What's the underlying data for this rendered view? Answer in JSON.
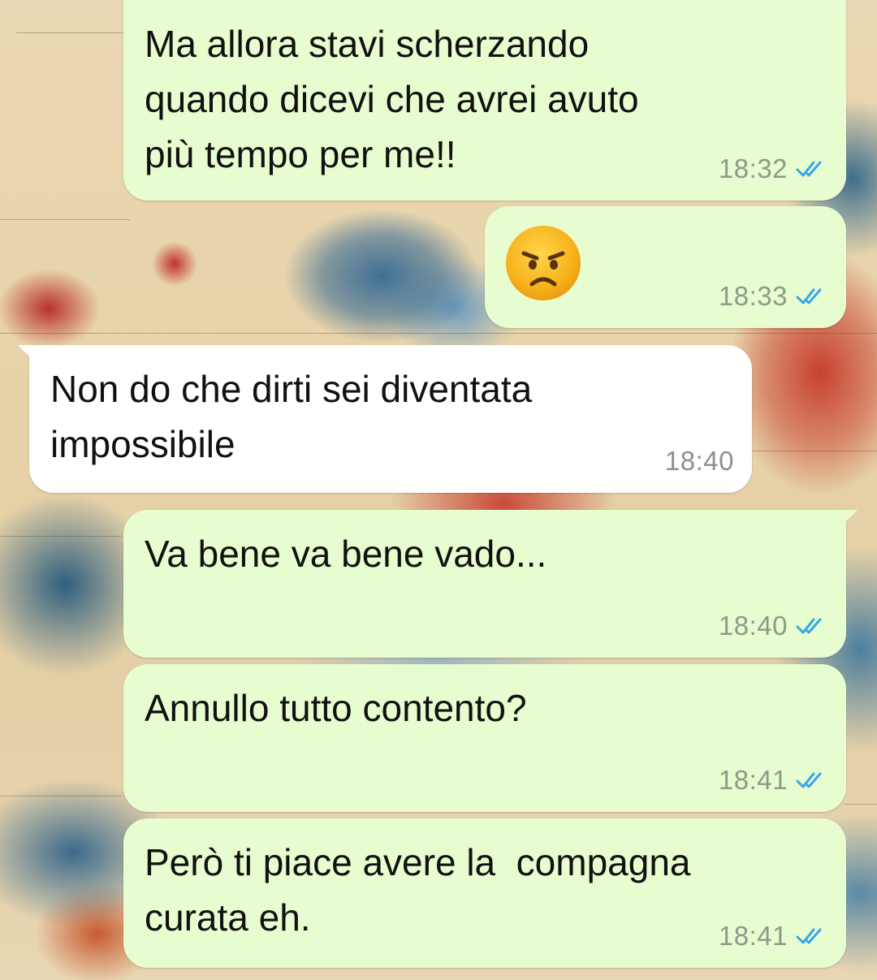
{
  "colors": {
    "outgoing_bubble": "#e7fccf",
    "incoming_bubble": "#ffffff",
    "read_ticks": "#3aa6e8",
    "timestamp": "#8d9a8a"
  },
  "messages": [
    {
      "direction": "outgoing",
      "text": "Ma allora stavi scherzando\nquando dicevi che avrei avuto\npiù tempo per me!!",
      "time": "18:32",
      "status_icon": "double-check-read-icon"
    },
    {
      "direction": "outgoing",
      "emoji": "angry-face-emoji",
      "text": "",
      "time": "18:33",
      "status_icon": "double-check-read-icon"
    },
    {
      "direction": "incoming",
      "text": "Non do che dirti sei diventata\nimpossibile",
      "time": "18:40"
    },
    {
      "direction": "outgoing",
      "text": "Va bene va bene vado...",
      "time": "18:40",
      "status_icon": "double-check-read-icon"
    },
    {
      "direction": "outgoing",
      "text": "Annullo tutto contento?",
      "time": "18:41",
      "status_icon": "double-check-read-icon"
    },
    {
      "direction": "outgoing",
      "text": "Però ti piace avere la  compagna\ncurata eh.",
      "time": "18:41",
      "status_icon": "double-check-read-icon"
    }
  ]
}
